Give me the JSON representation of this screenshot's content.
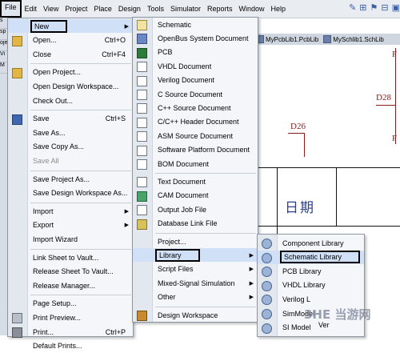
{
  "menubar": {
    "items": [
      "File",
      "Edit",
      "View",
      "Project",
      "Place",
      "Design",
      "Tools",
      "Simulator",
      "Reports",
      "Window",
      "Help"
    ]
  },
  "tabs": [
    "MyPcbLib1.PcbLib",
    "MySchlib1.SchLib"
  ],
  "left_strip": [
    "s",
    "sp",
    "oje",
    "Vi",
    "M"
  ],
  "canvas": {
    "labels": [
      "D26",
      "D28"
    ],
    "text": "日期",
    "partial_right": "F"
  },
  "file_menu": [
    {
      "label": "New",
      "shortcut": "",
      "submenu": true,
      "icon": "none"
    },
    {
      "label": "Open...",
      "shortcut": "Ctrl+O",
      "icon": "open-folder"
    },
    {
      "label": "Close",
      "shortcut": "Ctrl+F4"
    },
    {
      "sep": true
    },
    {
      "label": "Open Project...",
      "icon": "open-folder"
    },
    {
      "label": "Open Design Workspace..."
    },
    {
      "label": "Check Out..."
    },
    {
      "sep": true
    },
    {
      "label": "Save",
      "shortcut": "Ctrl+S",
      "icon": "save"
    },
    {
      "label": "Save As..."
    },
    {
      "label": "Save Copy As..."
    },
    {
      "label": "Save All",
      "disabled": true
    },
    {
      "sep": true
    },
    {
      "label": "Save Project As..."
    },
    {
      "label": "Save Design Workspace As..."
    },
    {
      "sep": true
    },
    {
      "label": "Import",
      "submenu": true
    },
    {
      "label": "Export",
      "submenu": true
    },
    {
      "label": "Import Wizard"
    },
    {
      "sep": true
    },
    {
      "label": "Link Sheet to Vault..."
    },
    {
      "label": "Release Sheet To Vault..."
    },
    {
      "label": "Release Manager..."
    },
    {
      "sep": true
    },
    {
      "label": "Page Setup..."
    },
    {
      "label": "Print Preview...",
      "icon": "preview"
    },
    {
      "label": "Print...",
      "shortcut": "Ctrl+P",
      "icon": "print"
    },
    {
      "label": "Default Prints..."
    }
  ],
  "new_menu": [
    {
      "label": "Schematic",
      "icon": "sch"
    },
    {
      "label": "OpenBus System Document",
      "icon": "bus"
    },
    {
      "label": "PCB",
      "icon": "pcb"
    },
    {
      "label": "VHDL Document",
      "icon": "doc"
    },
    {
      "label": "Verilog Document",
      "icon": "doc"
    },
    {
      "label": "C Source Document",
      "icon": "doc"
    },
    {
      "label": "C++ Source Document",
      "icon": "doc"
    },
    {
      "label": "C/C++ Header Document",
      "icon": "doc"
    },
    {
      "label": "ASM Source Document",
      "icon": "doc"
    },
    {
      "label": "Software Platform Document",
      "icon": "doc"
    },
    {
      "label": "BOM Document",
      "icon": "doc"
    },
    {
      "sep": true
    },
    {
      "label": "Text Document",
      "icon": "doc"
    },
    {
      "label": "CAM Document",
      "icon": "cam"
    },
    {
      "label": "Output Job File",
      "icon": "doc"
    },
    {
      "label": "Database Link File",
      "icon": "db"
    },
    {
      "sep": true
    },
    {
      "label": "Project...",
      "icon": "none"
    },
    {
      "label": "Library",
      "submenu": true,
      "highlight": true
    },
    {
      "label": "Script Files",
      "submenu": true
    },
    {
      "label": "Mixed-Signal Simulation",
      "submenu": true
    },
    {
      "label": "Other",
      "submenu": true
    },
    {
      "sep": true
    },
    {
      "label": "Design Workspace",
      "icon": "ws"
    }
  ],
  "library_menu": [
    {
      "label": "Component Library",
      "icon": "lib"
    },
    {
      "label": "Schematic Library",
      "icon": "lib",
      "highlight": true
    },
    {
      "label": "PCB Library",
      "icon": "lib"
    },
    {
      "label": "VHDL Library",
      "icon": "lib"
    },
    {
      "label": "Verilog L",
      "icon": "lib"
    },
    {
      "label": "SimModel",
      "icon": "lib"
    },
    {
      "label": "SI Model",
      "icon": "lib"
    }
  ],
  "watermark": "3HE 当游网",
  "partial_text": "Ver"
}
